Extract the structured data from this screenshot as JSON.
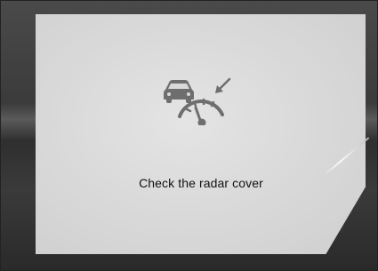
{
  "display": {
    "icon": "radar-sensor-warning-icon",
    "message": "Check the radar cover"
  },
  "colors": {
    "panel": "#d9d9d9",
    "icon": "#6e6e6e",
    "text": "#111111",
    "background": "#3b3b3b"
  }
}
